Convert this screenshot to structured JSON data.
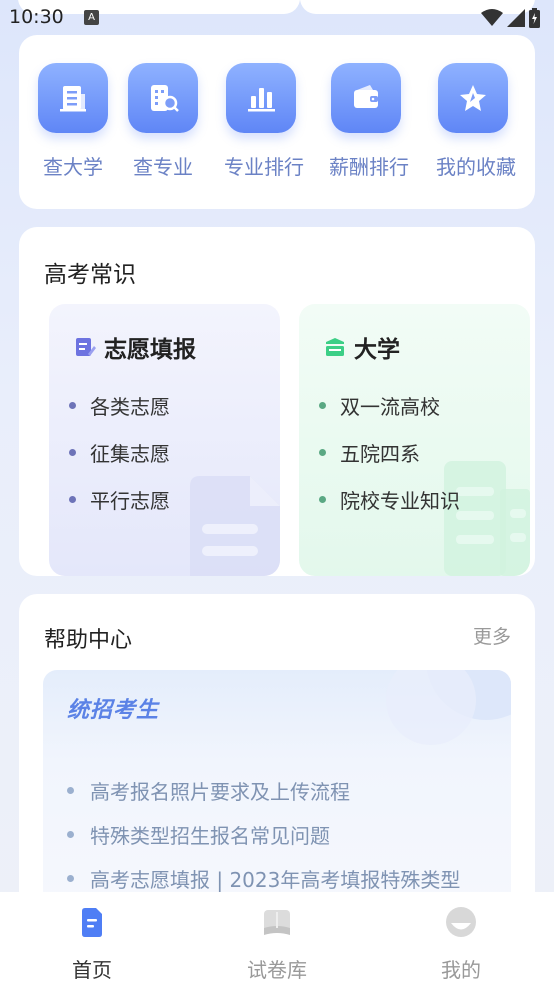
{
  "status": {
    "time": "10:30",
    "indicator": "A"
  },
  "quick_nav": [
    {
      "label": "查大学",
      "icon": "building-icon"
    },
    {
      "label": "查专业",
      "icon": "building-search-icon"
    },
    {
      "label": "专业排行",
      "icon": "bar-chart-icon"
    },
    {
      "label": "薪酬排行",
      "icon": "wallet-icon"
    },
    {
      "label": "我的收藏",
      "icon": "star-icon"
    }
  ],
  "knowledge": {
    "title": "高考常识",
    "cards": [
      {
        "title": "志愿填报",
        "icon": "edit-form-icon",
        "items": [
          "各类志愿",
          "征集志愿",
          "平行志愿"
        ],
        "accent": "#6d73e0"
      },
      {
        "title": "大学",
        "icon": "school-icon",
        "items": [
          "双一流高校",
          "五院四系",
          "院校专业知识"
        ],
        "accent": "#3ccf86"
      }
    ]
  },
  "help": {
    "title": "帮助中心",
    "more": "更多",
    "banner_title": "统招考生",
    "items": [
      "高考报名照片要求及上传流程",
      "特殊类型招生报名常见问题",
      "高考志愿填报 | 2023年高考填报特殊类型"
    ]
  },
  "tabs": [
    {
      "label": "首页",
      "icon": "home-doc-icon",
      "active": true
    },
    {
      "label": "试卷库",
      "icon": "book-icon",
      "active": false
    },
    {
      "label": "我的",
      "icon": "profile-icon",
      "active": false
    }
  ],
  "colors": {
    "accent": "#5f86f6",
    "active_tab": "#333333",
    "inactive_tab": "#999999"
  }
}
